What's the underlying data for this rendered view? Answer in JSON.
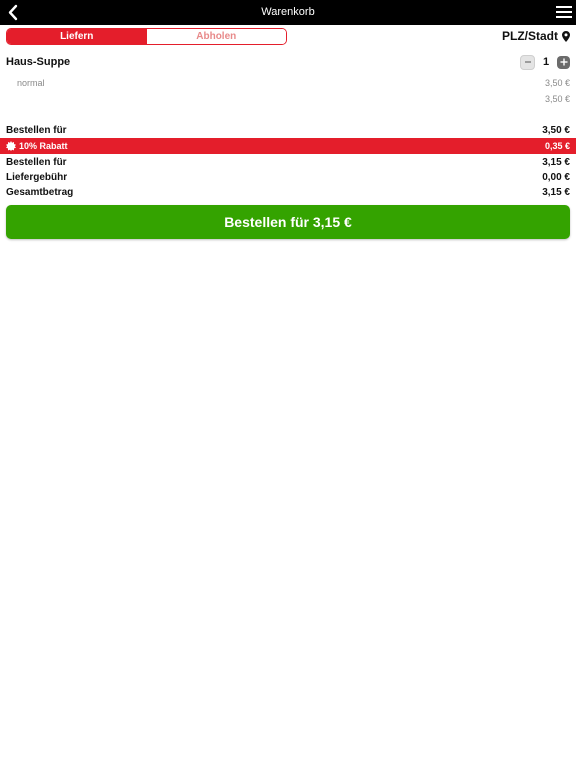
{
  "header": {
    "title": "Warenkorb",
    "back_icon": "chevron-left-icon",
    "menu_icon": "hamburger-menu-icon"
  },
  "mode_tabs": [
    {
      "label": "Liefern",
      "selected": true
    },
    {
      "label": "Abholen",
      "selected": false
    }
  ],
  "location": {
    "label": "PLZ/Stadt",
    "icon": "map-pin-icon"
  },
  "cart": {
    "items": [
      {
        "name": "Haus-Suppe",
        "quantity": "1",
        "option": "normal",
        "option_price": "3,50 €",
        "item_total": "3,50 €"
      }
    ]
  },
  "summary": {
    "subtotal_label": "Bestellen für",
    "subtotal_value": "3,50 €",
    "discount_label": "10% Rabatt",
    "discount_value": "0,35 €",
    "after_discount_label": "Bestellen für",
    "after_discount_value": "3,15 €",
    "delivery_label": "Liefergebühr",
    "delivery_value": "0,00 €",
    "total_label": "Gesamtbetrag",
    "total_value": "3,15 €"
  },
  "order_button": {
    "label": "Bestellen für 3,15 €"
  },
  "colors": {
    "brand_red": "#e41e2b",
    "order_green": "#34a300",
    "header_black": "#000000"
  }
}
